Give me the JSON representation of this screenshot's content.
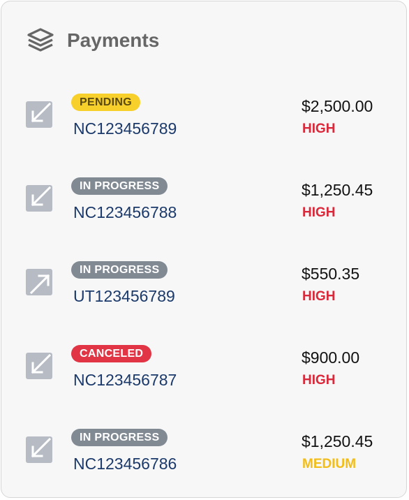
{
  "header": {
    "title": "Payments",
    "icon": "layers-icon"
  },
  "colors": {
    "pending": "#f7d02c",
    "in_progress": "#818a93",
    "canceled": "#e13545",
    "high": "#d9293a",
    "medium": "#f2bd18",
    "reference": "#1b3a6b"
  },
  "payments": [
    {
      "status": "PENDING",
      "reference": "NC123456789",
      "amount": "$2,500.00",
      "priority": "HIGH",
      "icon": "arrow-down-left-icon"
    },
    {
      "status": "IN PROGRESS",
      "reference": "NC123456788",
      "amount": "$1,250.45",
      "priority": "HIGH",
      "icon": "arrow-down-left-icon"
    },
    {
      "status": "IN PROGRESS",
      "reference": "UT123456789",
      "amount": "$550.35",
      "priority": "HIGH",
      "icon": "arrow-up-right-icon"
    },
    {
      "status": "CANCELED",
      "reference": "NC123456787",
      "amount": "$900.00",
      "priority": "HIGH",
      "icon": "arrow-down-left-icon"
    },
    {
      "status": "IN PROGRESS",
      "reference": "NC123456786",
      "amount": "$1,250.45",
      "priority": "MEDIUM",
      "icon": "arrow-down-left-icon"
    }
  ]
}
